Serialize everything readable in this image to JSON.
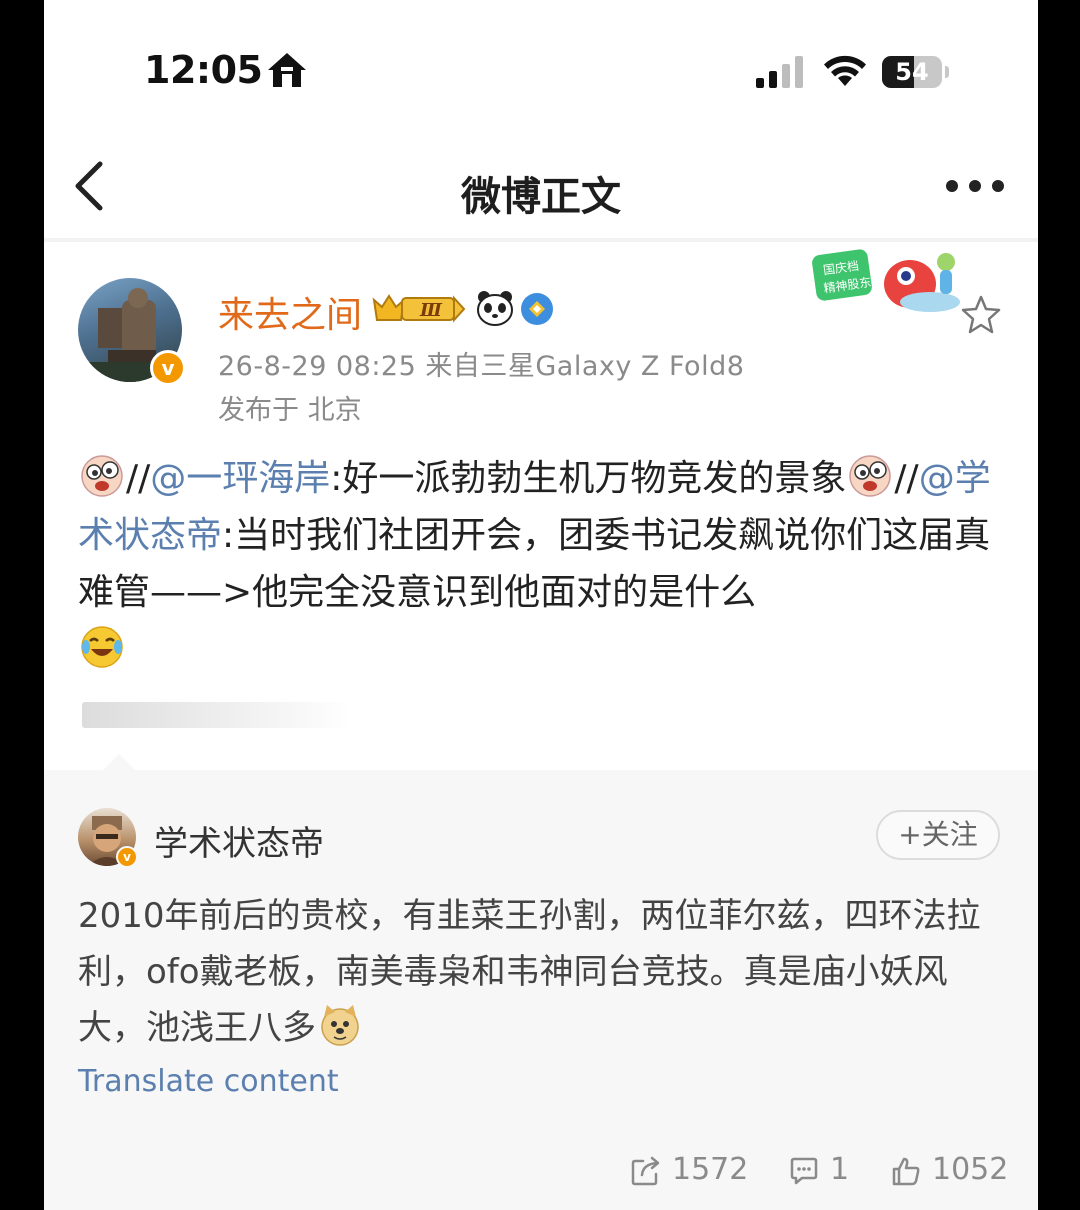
{
  "status_bar": {
    "time": "12:05",
    "battery_level": "54",
    "battery_percent": 54
  },
  "nav": {
    "title": "微博正文"
  },
  "post": {
    "author": {
      "name": "来去之间",
      "level_badge": "Ⅲ"
    },
    "meta": "26-8-29 08:25  来自三星Galaxy Z Fold8",
    "location": "发布于 北京",
    "body": {
      "part1": "//",
      "mention1": "@一玶海岸",
      "part2": ":好一派勃勃生机万物竞发的景象",
      "part3": "//",
      "mention2": "@学术状态帝",
      "part4": ":当时我们社团开会，团委书记发飙说你们这届真难管——>他完全没意识到他面对的是什么"
    },
    "promo_sticker": {
      "line1": "国庆档",
      "line2": "精神股东"
    }
  },
  "retweet": {
    "author": {
      "name": "学术状态帝"
    },
    "follow_label": "+关注",
    "body": "2010年前后的贵校，有韭菜王孙割，两位菲尔兹，四环法拉利，ofo戴老板，南美毒枭和韦神同台竞技。真是庙小妖风大，池浅王八多",
    "translate_label": "Translate content",
    "stats": {
      "reposts": "1572",
      "comments": "1",
      "likes": "1052"
    }
  },
  "colors": {
    "author_name": "#e0691a",
    "mention": "#5b7fae",
    "verified": "#f39800"
  }
}
